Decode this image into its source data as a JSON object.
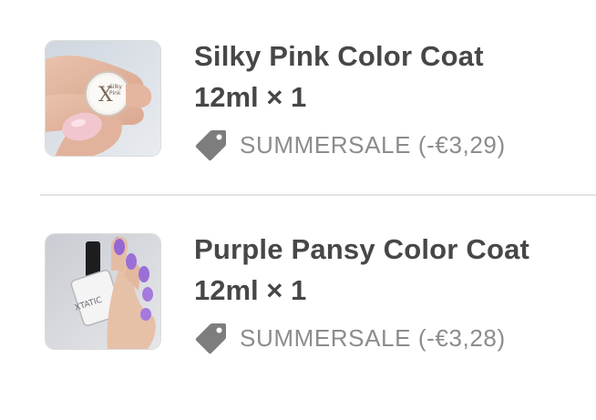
{
  "colors": {
    "title": "#474747",
    "discount": "#8c8c8c",
    "tag_icon": "#7d7d7d",
    "divider": "#e3e3e3"
  },
  "items": [
    {
      "name": "Silky Pink Color Coat",
      "quantity": "12ml × 1",
      "discount_icon": "tag-icon",
      "discount": "SUMMERSALE (-€3,29)",
      "bottle_label": [
        "Silky",
        "Pink"
      ]
    },
    {
      "name": "Purple Pansy Color Coat",
      "quantity": "12ml × 1",
      "discount_icon": "tag-icon",
      "discount": "SUMMERSALE (-€3,28)",
      "bottle_label": [
        "XTATIC"
      ]
    }
  ]
}
